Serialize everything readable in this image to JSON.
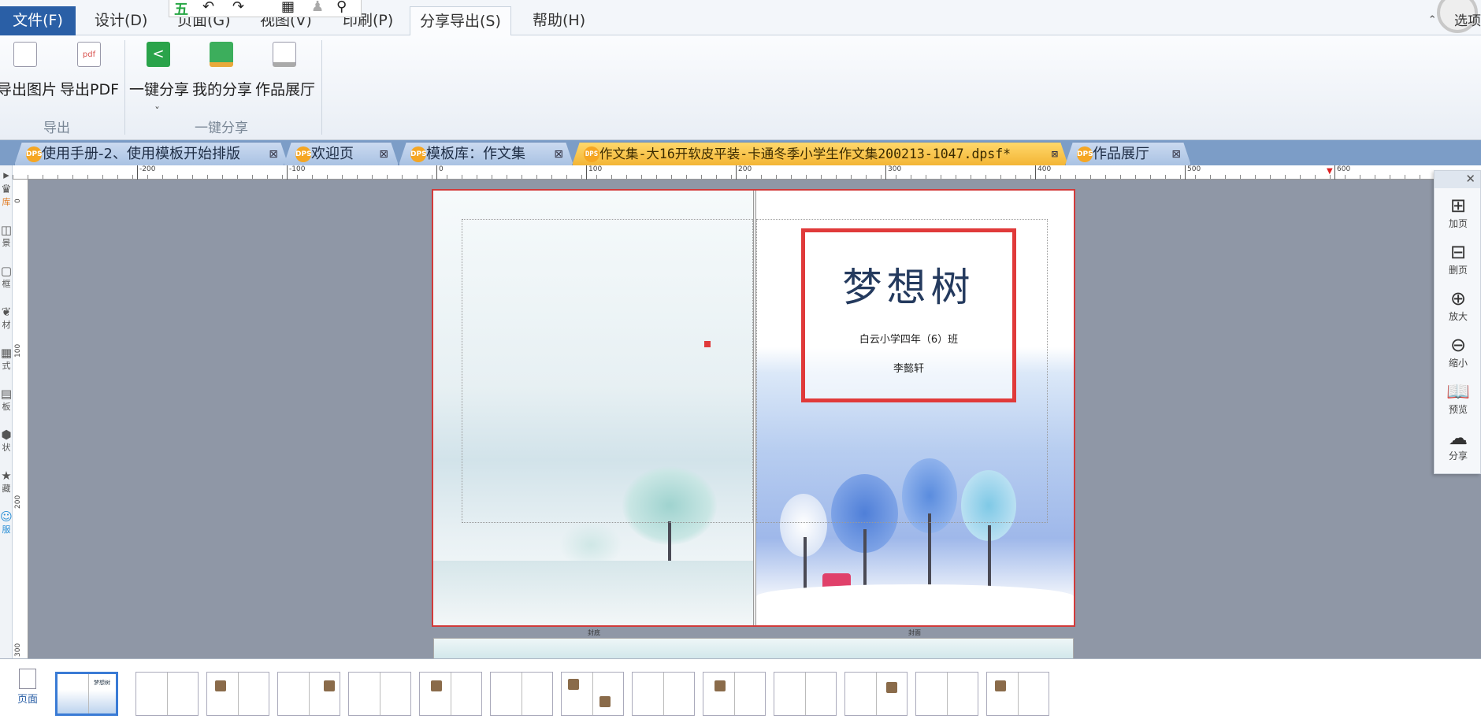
{
  "menubar": {
    "items": [
      "文件(F)",
      "设计(D)",
      "页面(G)",
      "视图(V)",
      "印刷(P)",
      "分享导出(S)",
      "帮助(H)"
    ],
    "quick_access": [
      "五",
      "↶",
      "↷",
      "▦",
      "♟",
      "⚲"
    ],
    "options_label": "选项",
    "help_glyphs": "⌃ ❓"
  },
  "ribbon": {
    "buttons": [
      {
        "label": "导出图片",
        "icon": "export-image-icon"
      },
      {
        "label": "导出PDF",
        "icon": "pdf-icon"
      },
      {
        "label": "一键分享",
        "icon": "share-icon"
      },
      {
        "label": "我的分享",
        "icon": "my-share-icon"
      },
      {
        "label": "作品展厅",
        "icon": "gallery-icon"
      }
    ],
    "dropdown_mark": "ˇ",
    "groups": [
      "导出",
      "一键分享"
    ]
  },
  "tabs": [
    {
      "label": "使用手册-2、使用模板开始排版",
      "active": false
    },
    {
      "label": "欢迎页",
      "active": false
    },
    {
      "label": "模板库：作文集",
      "active": false
    },
    {
      "label": "作文集-大16开软皮平装-卡通冬季小学生作文集200213-1047.dpsf*",
      "active": true
    },
    {
      "label": "作品展厅",
      "active": false
    }
  ],
  "tab_badge": "DPS",
  "tab_close": "⊠",
  "ruler": {
    "h_ticks": [
      "-200",
      "-100",
      "0",
      "100",
      "200",
      "300",
      "400",
      "500",
      "600"
    ],
    "v_ticks": [
      "0",
      "100",
      "200",
      "300"
    ]
  },
  "left_tools": [
    "库",
    "景",
    "框",
    "材",
    "式",
    "板",
    "状",
    "藏",
    "服"
  ],
  "cover": {
    "title": "梦想树",
    "class_name": "白云小学四年（6）班",
    "author": "李懿轩",
    "footer_left": "封底",
    "footer_right": "封面"
  },
  "right_panel": {
    "close": "✕",
    "buttons": [
      {
        "label": "加页",
        "glyph": "⊞"
      },
      {
        "label": "删页",
        "glyph": "⊟"
      },
      {
        "label": "放大",
        "glyph": "⊕"
      },
      {
        "label": "缩小",
        "glyph": "⊖"
      },
      {
        "label": "预览",
        "glyph": "📖"
      },
      {
        "label": "分享",
        "glyph": "☁"
      }
    ]
  },
  "thumbnails": {
    "pages_label": "页面",
    "count": 14,
    "selected_index": 0,
    "first_title": "梦想树"
  },
  "colors": {
    "accent": "#2a5fa6",
    "active_tab": "#f3b535",
    "highlight_red": "#e03a3a"
  }
}
